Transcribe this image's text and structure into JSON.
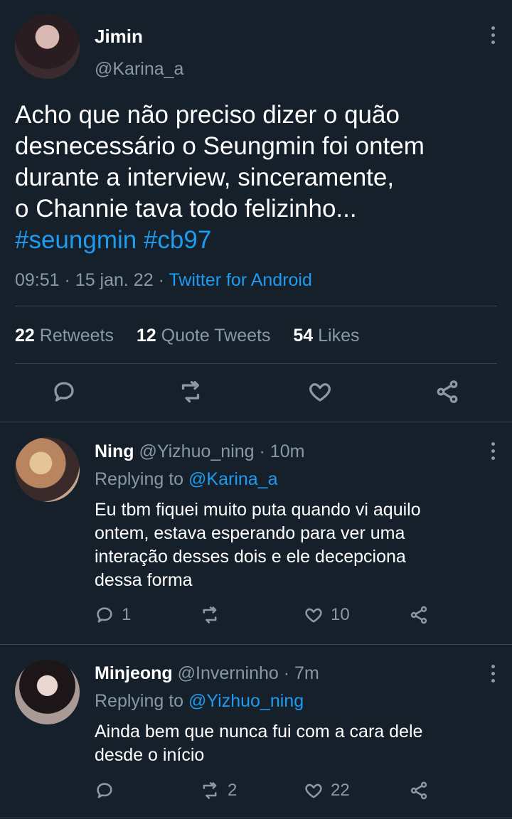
{
  "main_tweet": {
    "display_name": "Jimin",
    "handle": "@Karina_a",
    "text_lines": [
      "Acho que não preciso dizer o quão",
      "desnecessário o Seungmin foi ontem",
      "durante a interview, sinceramente,",
      "o Channie tava todo felizinho..."
    ],
    "hashtags": "#seungmin #cb97",
    "time": "09:51",
    "date": "15 jan. 22",
    "source": "Twitter for Android",
    "stats": {
      "retweets_count": "22",
      "retweets_label": "Retweets",
      "quotes_count": "12",
      "quotes_label": "Quote Tweets",
      "likes_count": "54",
      "likes_label": "Likes"
    }
  },
  "replies": [
    {
      "display_name": "Ning",
      "handle": "@Yizhuo_ning",
      "time": "· 10m",
      "replying_label": "Replying to",
      "replying_to": "@Karina_a",
      "text_lines": [
        "Eu tbm fiquei muito puta quando vi aquilo",
        "ontem, estava esperando para ver uma",
        "interação desses dois e ele decepciona",
        "dessa forma"
      ],
      "reply_count": "1",
      "retweet_count": "",
      "like_count": "10"
    },
    {
      "display_name": "Minjeong",
      "handle": "@Inverninho",
      "time": "· 7m",
      "replying_label": "Replying to",
      "replying_to": "@Yizhuo_ning",
      "text_lines": [
        "Ainda bem que nunca fui com a cara dele",
        "desde o início"
      ],
      "reply_count": "",
      "retweet_count": "2",
      "like_count": "22"
    }
  ],
  "colors": {
    "background": "#15202b",
    "accent": "#1d9bf0",
    "muted": "#8899a6",
    "divider": "#38444d"
  },
  "icons": [
    "comment-icon",
    "retweet-icon",
    "heart-icon",
    "share-icon",
    "more-options-icon"
  ]
}
